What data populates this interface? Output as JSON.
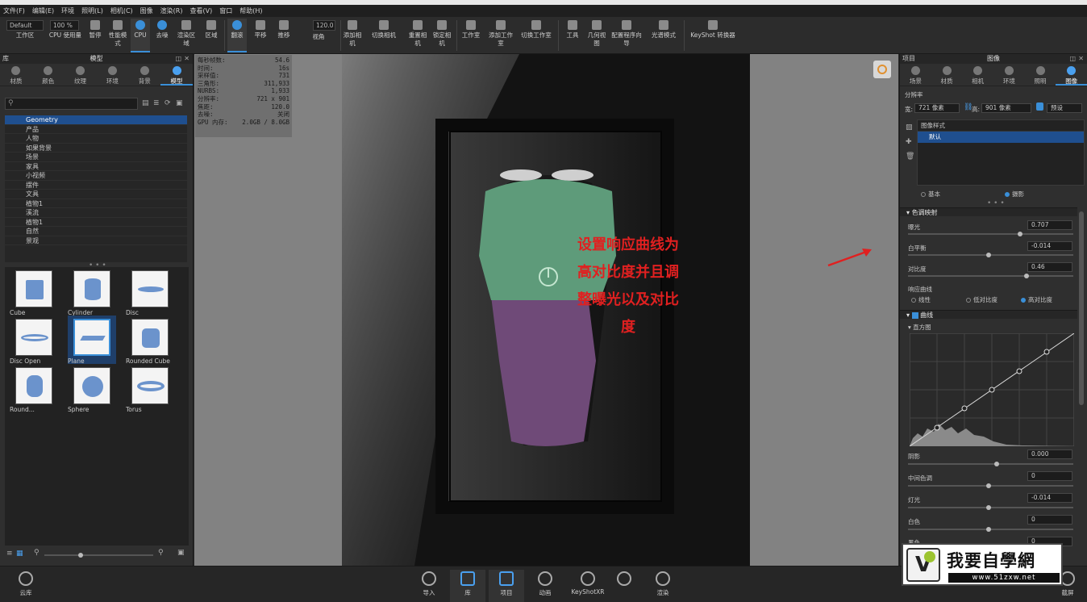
{
  "menu": [
    "文件(F)",
    "编辑(E)",
    "环境",
    "照明(L)",
    "相机(C)",
    "图像",
    "渲染(R)",
    "查看(V)",
    "窗口",
    "帮助(H)"
  ],
  "toolbar": {
    "preset_field": "Default",
    "zoom_field": "100 %",
    "buttons": [
      {
        "label": "工作区"
      },
      {
        "label": "CPU 使用量"
      },
      {
        "label": "暂停"
      },
      {
        "label": "性能模式"
      },
      {
        "label": "CPU"
      },
      {
        "label": "去噪"
      },
      {
        "label": "渲染区域"
      },
      {
        "label": "区域"
      },
      {
        "label": "翻滚"
      },
      {
        "label": "平移"
      },
      {
        "label": "推移"
      },
      {
        "label": "视角"
      },
      {
        "label": "添加相机"
      },
      {
        "label": "切换相机"
      },
      {
        "label": "重置相机"
      },
      {
        "label": "锁定相机"
      },
      {
        "label": "工作室"
      },
      {
        "label": "添加工作室"
      },
      {
        "label": "切换工作室"
      },
      {
        "label": "工具"
      },
      {
        "label": "几何视图"
      },
      {
        "label": "配置程序向导"
      },
      {
        "label": "光谱模式"
      },
      {
        "label": "KeyShot 转换器"
      }
    ],
    "fov_field": "120.0"
  },
  "library": {
    "title": "库",
    "panel_title": "模型",
    "tabs": [
      "材质",
      "颜色",
      "纹理",
      "环境",
      "背景",
      "模型"
    ],
    "active_tab": "模型",
    "tree": [
      "Geometry",
      "产品",
      "人物",
      "如果背景",
      "场景",
      "家具",
      "小视频",
      "摆件",
      "文具",
      "植物1",
      "溪流",
      "植物1",
      "自然",
      "景观"
    ],
    "selected_tree": "Geometry",
    "thumbnails": [
      {
        "name": "Cube"
      },
      {
        "name": "Cylinder"
      },
      {
        "name": "Disc"
      },
      {
        "name": "Disc Open"
      },
      {
        "name": "Plane"
      },
      {
        "name": "Rounded Cube"
      },
      {
        "name": "Round..."
      },
      {
        "name": "Sphere"
      },
      {
        "name": "Torus"
      }
    ],
    "selected_thumb": "Plane"
  },
  "stats": [
    {
      "k": "每秒帧数:",
      "v": "54.6"
    },
    {
      "k": "时间:",
      "v": "16s"
    },
    {
      "k": "采样值:",
      "v": "731"
    },
    {
      "k": "三角形:",
      "v": "311,933"
    },
    {
      "k": "NURBS:",
      "v": "1,933"
    },
    {
      "k": "分辨率:",
      "v": "721 x 901"
    },
    {
      "k": "焦距:",
      "v": "120.0"
    },
    {
      "k": "去噪:",
      "v": "关闭"
    },
    {
      "k": "GPU 内存:",
      "v": "2.0GB / 8.0GB"
    }
  ],
  "annotation": "设置响应曲线为高对比度并且调整曝光以及对比度",
  "project": {
    "title": "项目",
    "panel_title": "图像",
    "tabs": [
      "场景",
      "材质",
      "相机",
      "环境",
      "照明",
      "图像"
    ],
    "active_tab": "图像",
    "resolution_label": "分辨率",
    "width_label": "宽:",
    "width_value": "721 像素",
    "height_label": "高:",
    "height_value": "901 像素",
    "preset_button": "预设",
    "image_style_label": "图像样式",
    "style_item": "默认",
    "mode_basic": "基本",
    "mode_photo": "摄影",
    "tone_section": "色调映射",
    "exposure_label": "曝光",
    "exposure_value": "0.707",
    "wb_label": "白平衡",
    "wb_value": "-0.014",
    "contrast_label": "对比度",
    "contrast_value": "0.46",
    "response_label": "响应曲线",
    "resp_linear": "线性",
    "resp_low": "低对比度",
    "resp_high": "高对比度",
    "curve_section": "曲线",
    "histogram_label": "直方图",
    "shadows_label": "阴影",
    "shadows_value": "0.000",
    "midtones_label": "中间色调",
    "midtones_value": "0",
    "highlights_label": "灯光",
    "highlights_value": "-0.014",
    "whites_label": "白色",
    "whites_value": "0",
    "blacks_label": "黑色",
    "blacks_value": "0"
  },
  "bottom": {
    "cloud": "云库",
    "import": "导入",
    "library": "库",
    "project": "项目",
    "animation": "动画",
    "keyshotxr": "KeyShotXR",
    "render": "渲染",
    "screenshot": "截屏"
  },
  "watermark": {
    "text": "我要自學網",
    "url": "www.51zxw.net"
  }
}
